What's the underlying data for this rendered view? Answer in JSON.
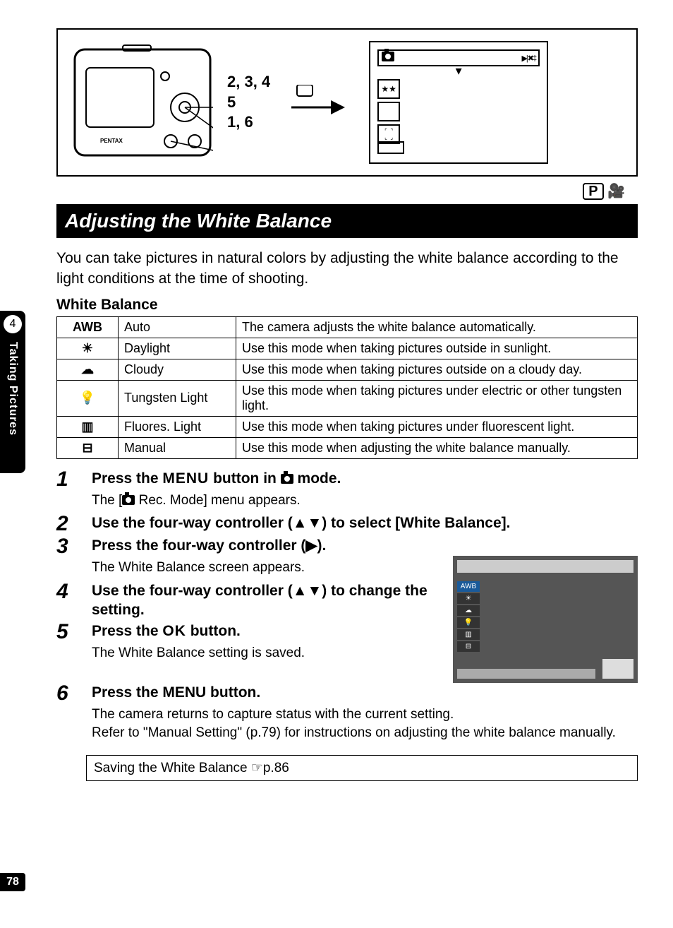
{
  "sidebar": {
    "chapter_number": "4",
    "chapter_title": "Taking Pictures"
  },
  "page_number": "78",
  "diagram": {
    "label_line1": "2, 3, 4",
    "label_line2": "5",
    "label_line3": "1, 6",
    "camera_brand": "PENTAX"
  },
  "mode_icons": {
    "p_label": "P"
  },
  "section_title": "Adjusting the White Balance",
  "intro_text": "You can take pictures in natural colors by adjusting the white balance according to the light conditions at the time of shooting.",
  "table_title": "White Balance",
  "wb_rows": [
    {
      "icon": "AWB",
      "name": "Auto",
      "desc": "The camera adjusts the white balance automatically."
    },
    {
      "icon": "☀",
      "name": "Daylight",
      "desc": "Use this mode when taking pictures outside in sunlight."
    },
    {
      "icon": "☁",
      "name": "Cloudy",
      "desc": "Use this mode when taking pictures outside on a cloudy day."
    },
    {
      "icon": "💡",
      "name": "Tungsten Light",
      "desc": "Use this mode when taking pictures under electric or other tungsten light."
    },
    {
      "icon": "▥",
      "name": "Fluores. Light",
      "desc": "Use this mode when taking pictures under fluorescent light."
    },
    {
      "icon": "⊟",
      "name": "Manual",
      "desc": "Use this mode when adjusting the white balance manually."
    }
  ],
  "steps": {
    "s1": {
      "num": "1",
      "title_pre": "Press the ",
      "title_menu": "MENU",
      "title_mid": " button in ",
      "title_post": " mode.",
      "body_pre": "The [",
      "body_post": " Rec. Mode] menu appears."
    },
    "s2": {
      "num": "2",
      "title": "Use the four-way controller (▲▼) to select [White Balance]."
    },
    "s3": {
      "num": "3",
      "title": "Press the four-way controller (▶).",
      "body": "The White Balance screen appears."
    },
    "s4": {
      "num": "4",
      "title": "Use the four-way controller (▲▼) to change the setting."
    },
    "s5": {
      "num": "5",
      "title_pre": "Press the ",
      "title_ok": "OK",
      "title_post": " button.",
      "body": "The White Balance setting is saved."
    },
    "s6": {
      "num": "6",
      "title": "Press the MENU button.",
      "body1": "The camera returns to capture status with the current setting.",
      "body2": "Refer to \"Manual Setting\" (p.79) for instructions on adjusting the white balance manually."
    }
  },
  "wb_screen": {
    "awb": "AWB"
  },
  "reference_box": "Saving the White Balance ☞p.86"
}
